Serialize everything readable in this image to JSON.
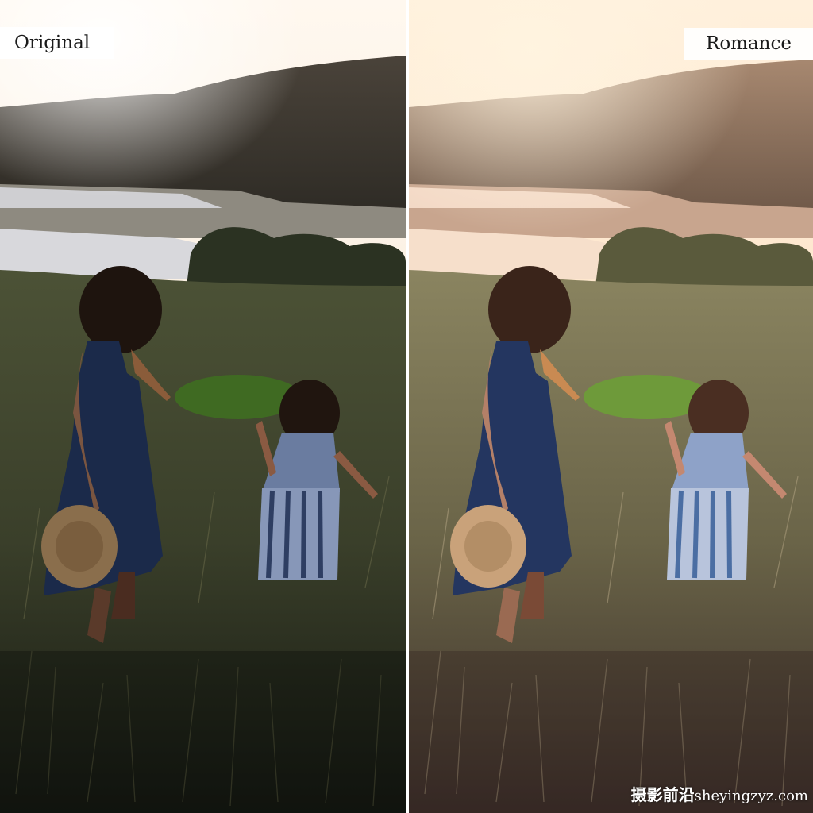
{
  "left_panel": {
    "label": "Original"
  },
  "right_panel": {
    "label": "Romance"
  },
  "watermark": {
    "cn_text": "摄影前沿",
    "domain_text": "sheyingzyz.com"
  },
  "colors": {
    "original_sky": "#fbf2e6",
    "romance_sky": "#fde2c2",
    "hill_dark": "#2a2620",
    "grass_dark": "#1e2318",
    "dress_navy": "#1b2a4a",
    "stripe_blue": "#4b6ea3"
  }
}
